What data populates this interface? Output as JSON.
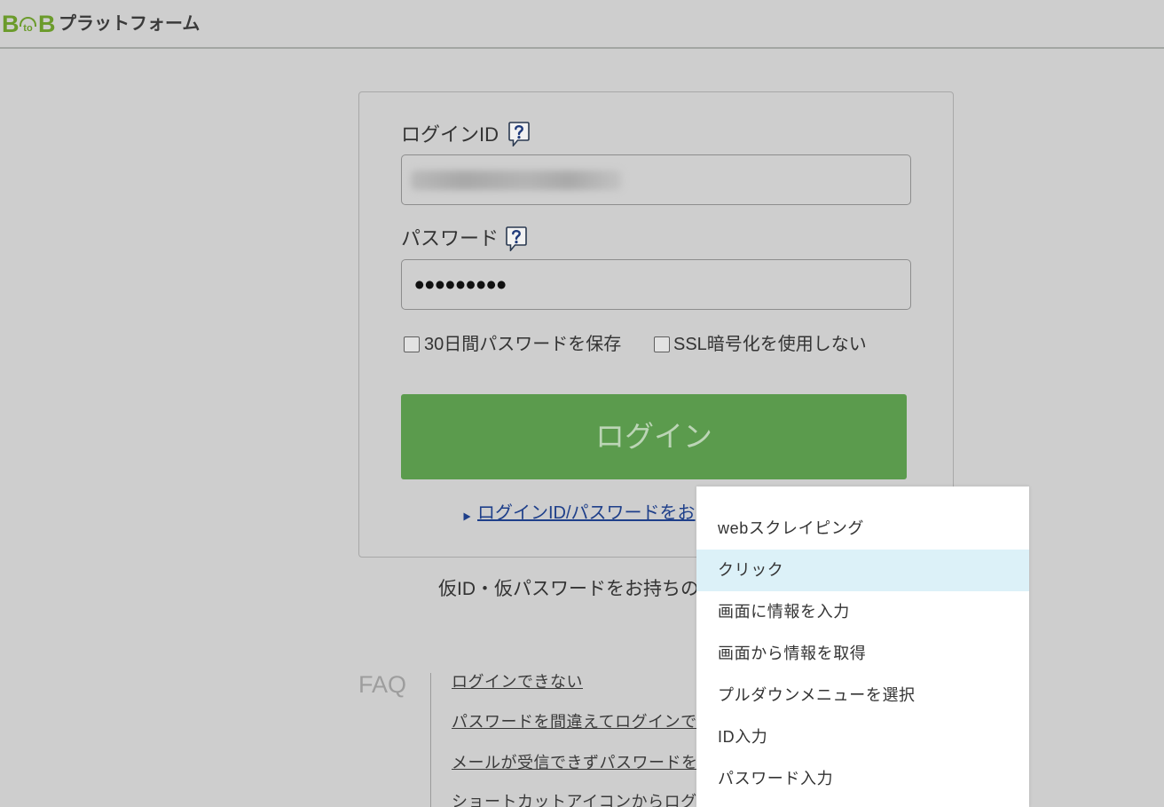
{
  "header": {
    "logo": {
      "b1": "B",
      "to": "to",
      "b2": "B",
      "text": "プラットフォーム"
    }
  },
  "login_form": {
    "login_id_label": "ログインID",
    "login_id_help_icon": "question-help-icon",
    "password_label": "パスワード",
    "password_help_icon": "question-help-icon",
    "password_value_masked": "•••••••••",
    "remember_password_label": "30日間パスワードを保存",
    "remember_password_checked": false,
    "disable_ssl_label": "SSL暗号化を使用しない",
    "disable_ssl_checked": false,
    "login_button_label": "ログイン",
    "forgot_link_icon": "triangle-right-icon",
    "forgot_link_text": "ログインID/パスワードをお"
  },
  "temp_credentials_text": "仮ID・仮パスワードをお持ちの",
  "faq": {
    "heading": "FAQ",
    "links": [
      "ログインできない",
      "パスワードを間違えてログインで",
      "メールが受信できずパスワードを",
      "ショートカットアイコンからログ"
    ]
  },
  "context_menu": {
    "items": [
      "webスクレイピング",
      "クリック",
      "画面に情報を入力",
      "画面から情報を取得",
      "プルダウンメニューを選択",
      "ID入力",
      "パスワード入力"
    ],
    "highlighted_index": 1
  },
  "colors": {
    "background": "#cecece",
    "brand_green": "#6b9b2b",
    "login_button": "#5b9b4d",
    "link_blue": "#1e3f8a",
    "menu_highlight": "#dcf1f8"
  }
}
